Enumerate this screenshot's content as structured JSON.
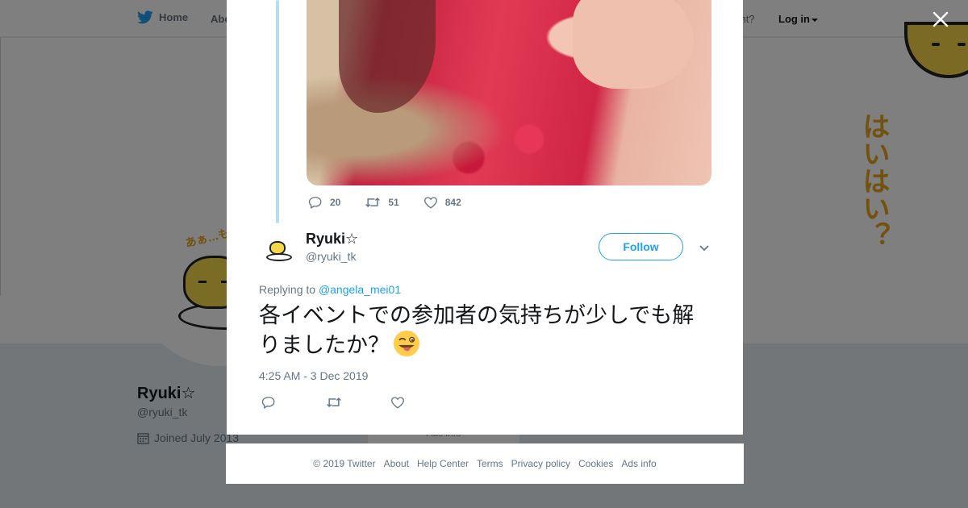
{
  "topbar": {
    "home_label": "Home",
    "about_label": "Abo",
    "have_account": "ccount?",
    "login_label": "Log in"
  },
  "banner": {
    "art_text": "はいはい？"
  },
  "avatar": {
    "scribble": "あぁ…も"
  },
  "profile": {
    "name": "Ryuki☆",
    "handle": "@ryuki_tk",
    "joined": "Joined July 2013",
    "ads_stub": "Ads info"
  },
  "prev_tweet": {
    "reply_count": "20",
    "retweet_count": "51",
    "like_count": "842"
  },
  "tweet": {
    "author_name": "Ryuki☆",
    "author_handle": "@ryuki_tk",
    "follow_label": "Follow",
    "replying_prefix": "Replying to",
    "replying_to": "@angela_mei01",
    "text": "各イベントでの参加者の気持ちが少しでも解りましたか？",
    "emoji": "winking-face-with-tongue",
    "timestamp": "4:25 AM - 3 Dec 2019"
  },
  "footer": {
    "copyright": "© 2019 Twitter",
    "links": [
      "About",
      "Help Center",
      "Terms",
      "Privacy policy",
      "Cookies",
      "Ads info"
    ]
  },
  "colors": {
    "accent": "#1da1f2",
    "text": "#14171a",
    "muted": "#657786",
    "thread_line": "#b8dcf2"
  }
}
